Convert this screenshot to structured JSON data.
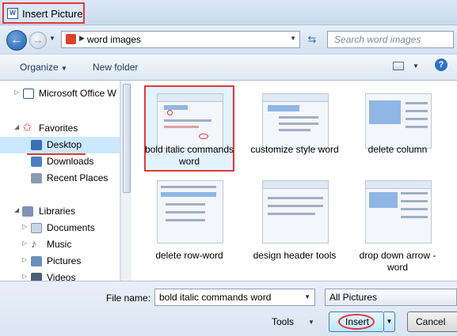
{
  "window": {
    "title": "Insert Picture",
    "icon": "word-document-icon"
  },
  "address": {
    "breadcrumb": "word images",
    "search_placeholder": "Search word images"
  },
  "toolbar": {
    "organize_label": "Organize",
    "new_folder_label": "New folder"
  },
  "nav_pane": {
    "items": [
      {
        "label": "Microsoft Office W",
        "icon": "word-icon",
        "level": 0,
        "expander": "▷"
      },
      {
        "label": "Favorites",
        "icon": "star-icon",
        "level": 0,
        "expander": "◢"
      },
      {
        "label": "Desktop",
        "icon": "desktop-icon",
        "level": 1,
        "expander": ""
      },
      {
        "label": "Downloads",
        "icon": "downloads-icon",
        "level": 1,
        "expander": ""
      },
      {
        "label": "Recent Places",
        "icon": "recent-places-icon",
        "level": 1,
        "expander": ""
      },
      {
        "label": "Libraries",
        "icon": "libraries-icon",
        "level": 0,
        "expander": "◢"
      },
      {
        "label": "Documents",
        "icon": "documents-icon",
        "level": 1,
        "expander": "▷"
      },
      {
        "label": "Music",
        "icon": "music-icon",
        "level": 1,
        "expander": "▷"
      },
      {
        "label": "Pictures",
        "icon": "pictures-icon",
        "level": 1,
        "expander": "▷"
      },
      {
        "label": "Videos",
        "icon": "videos-icon",
        "level": 1,
        "expander": "▷"
      }
    ]
  },
  "files": [
    {
      "label": "bold italic commands  word",
      "selected": true
    },
    {
      "label": "customize style word",
      "selected": false
    },
    {
      "label": "delete column",
      "selected": false
    },
    {
      "label": "delete row-word",
      "selected": false
    },
    {
      "label": "design header tools",
      "selected": false
    },
    {
      "label": "drop down arrow - word",
      "selected": false
    }
  ],
  "footer": {
    "file_name_label": "File name:",
    "file_name_value": "bold italic commands  word",
    "file_type_value": "All Pictures",
    "tools_label": "Tools",
    "insert_label": "Insert",
    "cancel_label": "Cancel"
  },
  "colors": {
    "highlight_red": "#e03a3a",
    "accent_blue": "#1e395b"
  }
}
